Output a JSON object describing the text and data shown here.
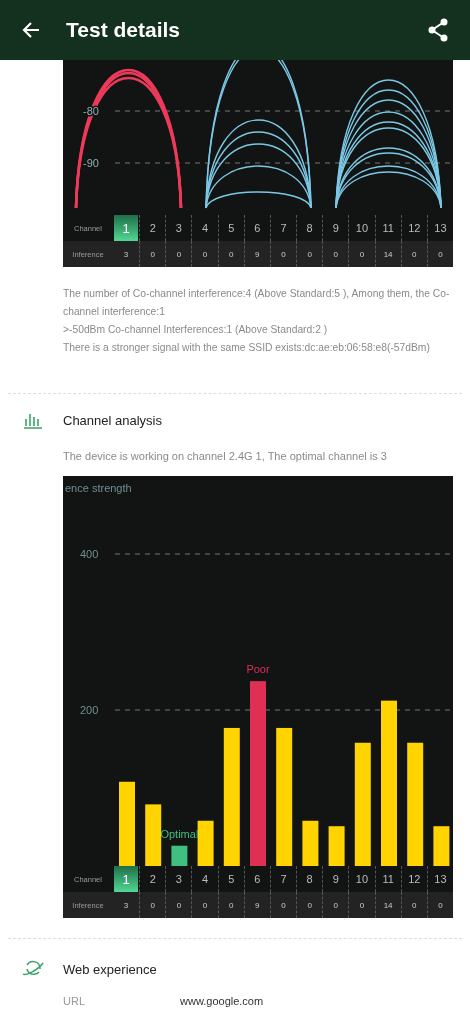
{
  "app_bar": {
    "title": "Test details"
  },
  "interference": {
    "y_ticks": [
      "-80",
      "-90"
    ],
    "table": {
      "row_labels": [
        "Channel",
        "Inference"
      ],
      "channels": [
        {
          "number": "1",
          "interference": "3",
          "selected": true
        },
        {
          "number": "2",
          "interference": "0",
          "selected": false
        },
        {
          "number": "3",
          "interference": "0",
          "selected": false
        },
        {
          "number": "4",
          "interference": "0",
          "selected": false
        },
        {
          "number": "5",
          "interference": "0",
          "selected": false
        },
        {
          "number": "6",
          "interference": "9",
          "selected": false
        },
        {
          "number": "7",
          "interference": "0",
          "selected": false
        },
        {
          "number": "8",
          "interference": "0",
          "selected": false
        },
        {
          "number": "9",
          "interference": "0",
          "selected": false
        },
        {
          "number": "10",
          "interference": "0",
          "selected": false
        },
        {
          "number": "11",
          "interference": "14",
          "selected": false
        },
        {
          "number": "12",
          "interference": "0",
          "selected": false
        },
        {
          "number": "13",
          "interference": "0",
          "selected": false
        }
      ]
    },
    "notes": [
      "The number of Co-channel interference:4 (Above Standard:5 ), Among them, the Co-channel interference:1",
      ">-50dBm Co-channel Interferences:1 (Above Standard:2 )",
      "There is a stronger signal with the same SSID exists:dc:ae:eb:06:58:e8(-57dBm)"
    ]
  },
  "channel_analysis": {
    "title": "Channel analysis",
    "summary": "The device is working on channel 2.4G 1, The optimal channel is 3",
    "chart_data": {
      "type": "bar",
      "ylabel": "ence strength",
      "categories": [
        "1",
        "2",
        "3",
        "4",
        "5",
        "6",
        "7",
        "8",
        "9",
        "10",
        "11",
        "12",
        "13"
      ],
      "series": [
        {
          "color": "#ffd400",
          "values": [
            108,
            79,
            null,
            58,
            177,
            null,
            177,
            58,
            51,
            158,
            212,
            158,
            51
          ]
        },
        {
          "color": "#3fbf80",
          "values": [
            null,
            null,
            26,
            null,
            null,
            null,
            null,
            null,
            null,
            null,
            null,
            null,
            null
          ]
        },
        {
          "color": "#e02f55",
          "values": [
            null,
            null,
            null,
            null,
            null,
            237,
            null,
            null,
            null,
            null,
            null,
            null,
            null
          ]
        }
      ],
      "ylim": [
        0,
        500
      ],
      "yticks": [
        200,
        400
      ],
      "annotations": [
        {
          "x": "3",
          "y": 26,
          "text": "Optimal"
        },
        {
          "x": "6",
          "y": 237,
          "text": "Poor"
        }
      ]
    },
    "table": {
      "row_labels": [
        "Channel",
        "Inference"
      ],
      "channels": [
        {
          "number": "1",
          "interference": "3",
          "selected": true
        },
        {
          "number": "2",
          "interference": "0",
          "selected": false
        },
        {
          "number": "3",
          "interference": "0",
          "selected": false
        },
        {
          "number": "4",
          "interference": "0",
          "selected": false
        },
        {
          "number": "5",
          "interference": "0",
          "selected": false
        },
        {
          "number": "6",
          "interference": "9",
          "selected": false
        },
        {
          "number": "7",
          "interference": "0",
          "selected": false
        },
        {
          "number": "8",
          "interference": "0",
          "selected": false
        },
        {
          "number": "9",
          "interference": "0",
          "selected": false
        },
        {
          "number": "10",
          "interference": "0",
          "selected": false
        },
        {
          "number": "11",
          "interference": "14",
          "selected": false
        },
        {
          "number": "12",
          "interference": "0",
          "selected": false
        },
        {
          "number": "13",
          "interference": "0",
          "selected": false
        }
      ]
    }
  },
  "web_experience": {
    "title": "Web experience",
    "rows": [
      {
        "label": "URL",
        "value": "www.google.com"
      }
    ]
  }
}
